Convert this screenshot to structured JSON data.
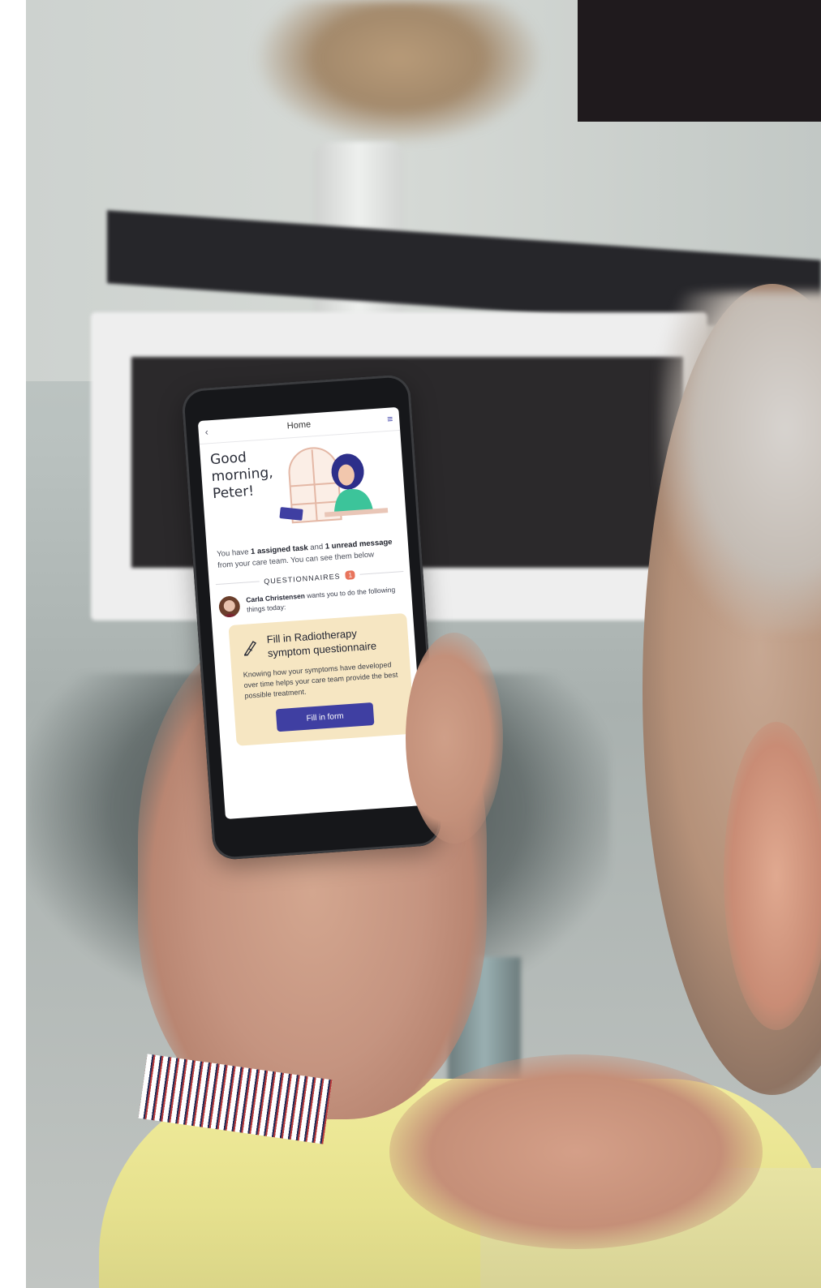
{
  "app": {
    "top_bar": {
      "title": "Home",
      "back_icon": "chevron-left-icon",
      "menu_icon": "hamburger-menu-icon"
    },
    "greeting": {
      "line1": "Good",
      "line2": "morning,",
      "line3": "Peter!"
    },
    "summary": {
      "prefix": "You have ",
      "tasks": "1 assigned task",
      "middle": " and ",
      "messages": "1 unread message",
      "suffix": " from your care team. You can see them below"
    },
    "questionnaires": {
      "heading": "QUESTIONNAIRES",
      "count": "1"
    },
    "assigner": {
      "name": "Carla Christensen",
      "text": " wants you to do the following things today:"
    },
    "task_card": {
      "title": "Fill in Radiotherapy symptom questionnaire",
      "description": "Knowing how your symptoms have developed over time helps your care team provide the best possible treatment.",
      "button_label": "Fill in form",
      "icon": "pen-icon"
    },
    "colors": {
      "accent": "#3f3fa2",
      "card_bg": "#f6e6c2",
      "badge": "#e8745c"
    }
  }
}
